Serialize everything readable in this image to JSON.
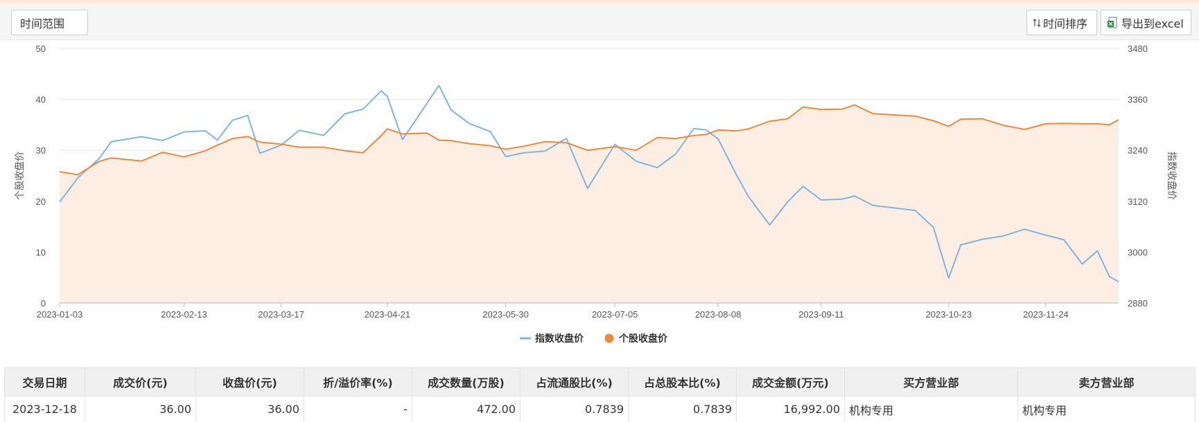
{
  "toolbar": {
    "time_range_label": "时间范围",
    "time_sort_label": "时间排序",
    "export_label": "导出到excel"
  },
  "colors": {
    "index_line": "#7eb5e1",
    "stock_line": "#ed8a3a",
    "area_fill": "#fdeee3",
    "grid": "#e6e6e6"
  },
  "chart_data": {
    "type": "line",
    "title": "",
    "ylabel": "个股收盘价",
    "y2label": "指数收盘价",
    "ylim": [
      0,
      50
    ],
    "y2lim": [
      2880,
      3480
    ],
    "yticks": [
      0,
      10,
      20,
      30,
      40,
      50
    ],
    "y2ticks": [
      2880,
      3000,
      3120,
      3240,
      3360,
      3480
    ],
    "x_range": [
      "2023-01-03",
      "2023-12-18"
    ],
    "xticks": [
      "2023-01-03",
      "2023-02-13",
      "2023-03-17",
      "2023-04-21",
      "2023-05-30",
      "2023-07-05",
      "2023-08-08",
      "2023-09-11",
      "2023-10-23",
      "2023-11-24"
    ],
    "grid": true,
    "legend_position": "bottom-center",
    "series": [
      {
        "name": "指数收盘价",
        "axis": "right",
        "color": "#7eb5e1",
        "points": [
          [
            "2023-01-03",
            3118
          ],
          [
            "2023-01-09",
            3175
          ],
          [
            "2023-01-16",
            3220
          ],
          [
            "2023-01-20",
            3260
          ],
          [
            "2023-01-30",
            3272
          ],
          [
            "2023-02-06",
            3263
          ],
          [
            "2023-02-13",
            3283
          ],
          [
            "2023-02-20",
            3286
          ],
          [
            "2023-02-24",
            3264
          ],
          [
            "2023-03-01",
            3311
          ],
          [
            "2023-03-06",
            3322
          ],
          [
            "2023-03-10",
            3233
          ],
          [
            "2023-03-17",
            3252
          ],
          [
            "2023-03-23",
            3287
          ],
          [
            "2023-03-31",
            3275
          ],
          [
            "2023-04-07",
            3326
          ],
          [
            "2023-04-13",
            3337
          ],
          [
            "2023-04-19",
            3380
          ],
          [
            "2023-04-21",
            3367
          ],
          [
            "2023-04-26",
            3265
          ],
          [
            "2023-05-04",
            3350
          ],
          [
            "2023-05-08",
            3393
          ],
          [
            "2023-05-12",
            3335
          ],
          [
            "2023-05-18",
            3303
          ],
          [
            "2023-05-25",
            3284
          ],
          [
            "2023-05-30",
            3225
          ],
          [
            "2023-06-05",
            3234
          ],
          [
            "2023-06-12",
            3238
          ],
          [
            "2023-06-19",
            3268
          ],
          [
            "2023-06-26",
            3150
          ],
          [
            "2023-07-05",
            3254
          ],
          [
            "2023-07-12",
            3214
          ],
          [
            "2023-07-19",
            3199
          ],
          [
            "2023-07-25",
            3231
          ],
          [
            "2023-07-31",
            3291
          ],
          [
            "2023-08-04",
            3288
          ],
          [
            "2023-08-08",
            3267
          ],
          [
            "2023-08-14",
            3183
          ],
          [
            "2023-08-18",
            3131
          ],
          [
            "2023-08-25",
            3064
          ],
          [
            "2023-08-31",
            3119
          ],
          [
            "2023-09-05",
            3155
          ],
          [
            "2023-09-11",
            3123
          ],
          [
            "2023-09-18",
            3125
          ],
          [
            "2023-09-22",
            3132
          ],
          [
            "2023-09-28",
            3110
          ],
          [
            "2023-10-12",
            3098
          ],
          [
            "2023-10-18",
            3058
          ],
          [
            "2023-10-23",
            2939
          ],
          [
            "2023-10-27",
            3017
          ],
          [
            "2023-11-03",
            3030
          ],
          [
            "2023-11-10",
            3038
          ],
          [
            "2023-11-17",
            3054
          ],
          [
            "2023-11-24",
            3040
          ],
          [
            "2023-11-30",
            3029
          ],
          [
            "2023-12-06",
            2972
          ],
          [
            "2023-12-11",
            3003
          ],
          [
            "2023-12-15",
            2942
          ],
          [
            "2023-12-18",
            2930
          ]
        ]
      },
      {
        "name": "个股收盘价",
        "axis": "left",
        "color": "#ed8a3a",
        "points": [
          [
            "2023-01-03",
            25.8
          ],
          [
            "2023-01-09",
            25.2
          ],
          [
            "2023-01-16",
            27.8
          ],
          [
            "2023-01-20",
            28.5
          ],
          [
            "2023-01-30",
            27.9
          ],
          [
            "2023-02-06",
            29.6
          ],
          [
            "2023-02-13",
            28.7
          ],
          [
            "2023-02-20",
            29.9
          ],
          [
            "2023-02-24",
            31.0
          ],
          [
            "2023-03-01",
            32.3
          ],
          [
            "2023-03-06",
            32.7
          ],
          [
            "2023-03-10",
            31.6
          ],
          [
            "2023-03-17",
            31.2
          ],
          [
            "2023-03-23",
            30.6
          ],
          [
            "2023-03-31",
            30.6
          ],
          [
            "2023-04-07",
            29.9
          ],
          [
            "2023-04-13",
            29.5
          ],
          [
            "2023-04-19",
            32.9
          ],
          [
            "2023-04-21",
            34.2
          ],
          [
            "2023-04-26",
            33.2
          ],
          [
            "2023-05-04",
            33.4
          ],
          [
            "2023-05-08",
            32.0
          ],
          [
            "2023-05-12",
            31.9
          ],
          [
            "2023-05-18",
            31.3
          ],
          [
            "2023-05-25",
            30.9
          ],
          [
            "2023-05-30",
            30.2
          ],
          [
            "2023-06-05",
            30.8
          ],
          [
            "2023-06-12",
            31.7
          ],
          [
            "2023-06-19",
            31.5
          ],
          [
            "2023-06-26",
            30.0
          ],
          [
            "2023-07-05",
            30.7
          ],
          [
            "2023-07-12",
            30.0
          ],
          [
            "2023-07-19",
            32.5
          ],
          [
            "2023-07-25",
            32.3
          ],
          [
            "2023-07-31",
            32.9
          ],
          [
            "2023-08-04",
            33.1
          ],
          [
            "2023-08-08",
            34.0
          ],
          [
            "2023-08-14",
            33.8
          ],
          [
            "2023-08-18",
            34.2
          ],
          [
            "2023-08-25",
            35.7
          ],
          [
            "2023-08-31",
            36.2
          ],
          [
            "2023-09-05",
            38.5
          ],
          [
            "2023-09-11",
            38.0
          ],
          [
            "2023-09-18",
            38.1
          ],
          [
            "2023-09-22",
            38.9
          ],
          [
            "2023-09-28",
            37.2
          ],
          [
            "2023-10-12",
            36.7
          ],
          [
            "2023-10-18",
            35.8
          ],
          [
            "2023-10-23",
            34.7
          ],
          [
            "2023-10-27",
            36.1
          ],
          [
            "2023-11-03",
            36.2
          ],
          [
            "2023-11-10",
            34.9
          ],
          [
            "2023-11-17",
            34.1
          ],
          [
            "2023-11-24",
            35.2
          ],
          [
            "2023-11-30",
            35.3
          ],
          [
            "2023-12-06",
            35.2
          ],
          [
            "2023-12-11",
            35.2
          ],
          [
            "2023-12-15",
            35.0
          ],
          [
            "2023-12-18",
            36.0
          ]
        ]
      }
    ]
  },
  "table": {
    "headers": [
      "交易日期",
      "成交价(元)",
      "收盘价(元)",
      "折/溢价率(%)",
      "成交数量(万股)",
      "占流通股比(%)",
      "占总股本比(%)",
      "成交金额(万元)",
      "买方营业部",
      "卖方营业部"
    ],
    "rows": [
      [
        "2023-12-18",
        "36.00",
        "36.00",
        "-",
        "472.00",
        "0.7839",
        "0.7839",
        "16,992.00",
        "机构专用",
        "机构专用"
      ]
    ]
  }
}
